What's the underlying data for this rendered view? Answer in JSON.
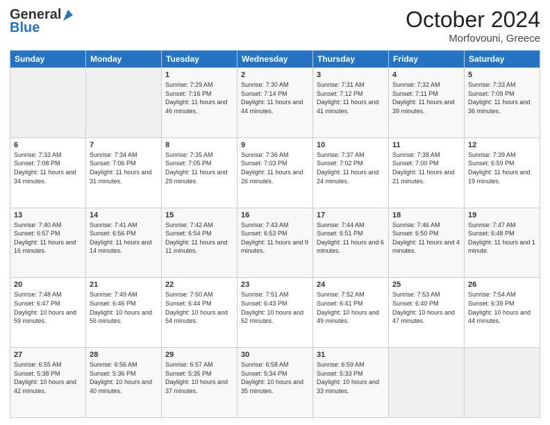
{
  "header": {
    "logo_general": "General",
    "logo_blue": "Blue",
    "month": "October 2024",
    "location": "Morfovouni, Greece"
  },
  "days_of_week": [
    "Sunday",
    "Monday",
    "Tuesday",
    "Wednesday",
    "Thursday",
    "Friday",
    "Saturday"
  ],
  "weeks": [
    [
      {
        "day": "",
        "sunrise": "",
        "sunset": "",
        "daylight": ""
      },
      {
        "day": "",
        "sunrise": "",
        "sunset": "",
        "daylight": ""
      },
      {
        "day": "1",
        "sunrise": "Sunrise: 7:29 AM",
        "sunset": "Sunset: 7:16 PM",
        "daylight": "Daylight: 11 hours and 46 minutes."
      },
      {
        "day": "2",
        "sunrise": "Sunrise: 7:30 AM",
        "sunset": "Sunset: 7:14 PM",
        "daylight": "Daylight: 11 hours and 44 minutes."
      },
      {
        "day": "3",
        "sunrise": "Sunrise: 7:31 AM",
        "sunset": "Sunset: 7:12 PM",
        "daylight": "Daylight: 11 hours and 41 minutes."
      },
      {
        "day": "4",
        "sunrise": "Sunrise: 7:32 AM",
        "sunset": "Sunset: 7:11 PM",
        "daylight": "Daylight: 11 hours and 39 minutes."
      },
      {
        "day": "5",
        "sunrise": "Sunrise: 7:33 AM",
        "sunset": "Sunset: 7:09 PM",
        "daylight": "Daylight: 11 hours and 36 minutes."
      }
    ],
    [
      {
        "day": "6",
        "sunrise": "Sunrise: 7:33 AM",
        "sunset": "Sunset: 7:08 PM",
        "daylight": "Daylight: 11 hours and 34 minutes."
      },
      {
        "day": "7",
        "sunrise": "Sunrise: 7:34 AM",
        "sunset": "Sunset: 7:06 PM",
        "daylight": "Daylight: 11 hours and 31 minutes."
      },
      {
        "day": "8",
        "sunrise": "Sunrise: 7:35 AM",
        "sunset": "Sunset: 7:05 PM",
        "daylight": "Daylight: 11 hours and 29 minutes."
      },
      {
        "day": "9",
        "sunrise": "Sunrise: 7:36 AM",
        "sunset": "Sunset: 7:03 PM",
        "daylight": "Daylight: 11 hours and 26 minutes."
      },
      {
        "day": "10",
        "sunrise": "Sunrise: 7:37 AM",
        "sunset": "Sunset: 7:02 PM",
        "daylight": "Daylight: 11 hours and 24 minutes."
      },
      {
        "day": "11",
        "sunrise": "Sunrise: 7:38 AM",
        "sunset": "Sunset: 7:00 PM",
        "daylight": "Daylight: 11 hours and 21 minutes."
      },
      {
        "day": "12",
        "sunrise": "Sunrise: 7:39 AM",
        "sunset": "Sunset: 6:59 PM",
        "daylight": "Daylight: 11 hours and 19 minutes."
      }
    ],
    [
      {
        "day": "13",
        "sunrise": "Sunrise: 7:40 AM",
        "sunset": "Sunset: 6:57 PM",
        "daylight": "Daylight: 11 hours and 16 minutes."
      },
      {
        "day": "14",
        "sunrise": "Sunrise: 7:41 AM",
        "sunset": "Sunset: 6:56 PM",
        "daylight": "Daylight: 11 hours and 14 minutes."
      },
      {
        "day": "15",
        "sunrise": "Sunrise: 7:42 AM",
        "sunset": "Sunset: 6:54 PM",
        "daylight": "Daylight: 11 hours and 11 minutes."
      },
      {
        "day": "16",
        "sunrise": "Sunrise: 7:43 AM",
        "sunset": "Sunset: 6:53 PM",
        "daylight": "Daylight: 11 hours and 9 minutes."
      },
      {
        "day": "17",
        "sunrise": "Sunrise: 7:44 AM",
        "sunset": "Sunset: 6:51 PM",
        "daylight": "Daylight: 11 hours and 6 minutes."
      },
      {
        "day": "18",
        "sunrise": "Sunrise: 7:46 AM",
        "sunset": "Sunset: 6:50 PM",
        "daylight": "Daylight: 11 hours and 4 minutes."
      },
      {
        "day": "19",
        "sunrise": "Sunrise: 7:47 AM",
        "sunset": "Sunset: 6:48 PM",
        "daylight": "Daylight: 11 hours and 1 minute."
      }
    ],
    [
      {
        "day": "20",
        "sunrise": "Sunrise: 7:48 AM",
        "sunset": "Sunset: 6:47 PM",
        "daylight": "Daylight: 10 hours and 59 minutes."
      },
      {
        "day": "21",
        "sunrise": "Sunrise: 7:49 AM",
        "sunset": "Sunset: 6:46 PM",
        "daylight": "Daylight: 10 hours and 56 minutes."
      },
      {
        "day": "22",
        "sunrise": "Sunrise: 7:50 AM",
        "sunset": "Sunset: 6:44 PM",
        "daylight": "Daylight: 10 hours and 54 minutes."
      },
      {
        "day": "23",
        "sunrise": "Sunrise: 7:51 AM",
        "sunset": "Sunset: 6:43 PM",
        "daylight": "Daylight: 10 hours and 52 minutes."
      },
      {
        "day": "24",
        "sunrise": "Sunrise: 7:52 AM",
        "sunset": "Sunset: 6:41 PM",
        "daylight": "Daylight: 10 hours and 49 minutes."
      },
      {
        "day": "25",
        "sunrise": "Sunrise: 7:53 AM",
        "sunset": "Sunset: 6:40 PM",
        "daylight": "Daylight: 10 hours and 47 minutes."
      },
      {
        "day": "26",
        "sunrise": "Sunrise: 7:54 AM",
        "sunset": "Sunset: 6:39 PM",
        "daylight": "Daylight: 10 hours and 44 minutes."
      }
    ],
    [
      {
        "day": "27",
        "sunrise": "Sunrise: 6:55 AM",
        "sunset": "Sunset: 5:38 PM",
        "daylight": "Daylight: 10 hours and 42 minutes."
      },
      {
        "day": "28",
        "sunrise": "Sunrise: 6:56 AM",
        "sunset": "Sunset: 5:36 PM",
        "daylight": "Daylight: 10 hours and 40 minutes."
      },
      {
        "day": "29",
        "sunrise": "Sunrise: 6:57 AM",
        "sunset": "Sunset: 5:35 PM",
        "daylight": "Daylight: 10 hours and 37 minutes."
      },
      {
        "day": "30",
        "sunrise": "Sunrise: 6:58 AM",
        "sunset": "Sunset: 5:34 PM",
        "daylight": "Daylight: 10 hours and 35 minutes."
      },
      {
        "day": "31",
        "sunrise": "Sunrise: 6:59 AM",
        "sunset": "Sunset: 5:33 PM",
        "daylight": "Daylight: 10 hours and 33 minutes."
      },
      {
        "day": "",
        "sunrise": "",
        "sunset": "",
        "daylight": ""
      },
      {
        "day": "",
        "sunrise": "",
        "sunset": "",
        "daylight": ""
      }
    ]
  ]
}
